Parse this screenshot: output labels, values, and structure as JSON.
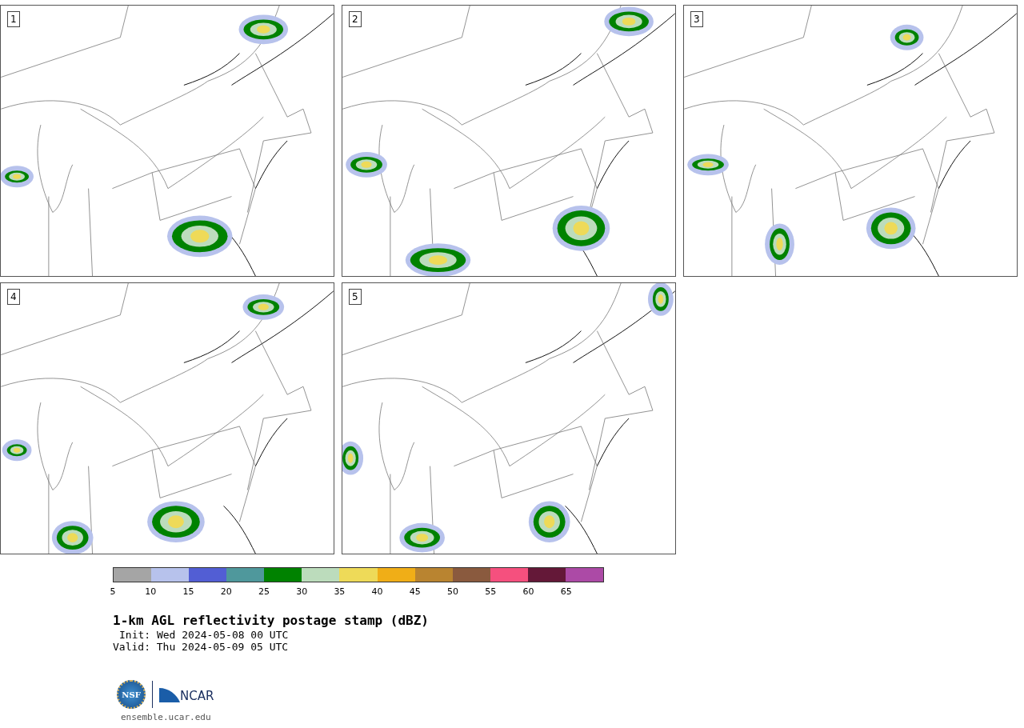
{
  "panels": [
    {
      "label": "1"
    },
    {
      "label": "2"
    },
    {
      "label": "3"
    },
    {
      "label": "4"
    },
    {
      "label": "5"
    }
  ],
  "colorbar": {
    "segments": [
      {
        "color": "#a5a5a5"
      },
      {
        "color": "#b7c2ec"
      },
      {
        "color": "#525ed4"
      },
      {
        "color": "#4f989c"
      },
      {
        "color": "#008200"
      },
      {
        "color": "#bcdcbc"
      },
      {
        "color": "#eeda58"
      },
      {
        "color": "#f0ae17"
      },
      {
        "color": "#b98430"
      },
      {
        "color": "#8a5a3e"
      },
      {
        "color": "#f5507e"
      },
      {
        "color": "#641838"
      },
      {
        "color": "#ac4aa6"
      }
    ],
    "ticks": [
      "5",
      "10",
      "15",
      "20",
      "25",
      "30",
      "35",
      "40",
      "45",
      "50",
      "55",
      "60",
      "65"
    ]
  },
  "title": "1-km AGL reflectivity postage stamp (dBZ)",
  "init": "Init: Wed 2024-05-08 00 UTC",
  "valid": "Valid: Thu 2024-05-09 05 UTC",
  "logo": {
    "nsf": "NSF",
    "ncar": "NCAR"
  },
  "url": "ensemble.ucar.edu"
}
